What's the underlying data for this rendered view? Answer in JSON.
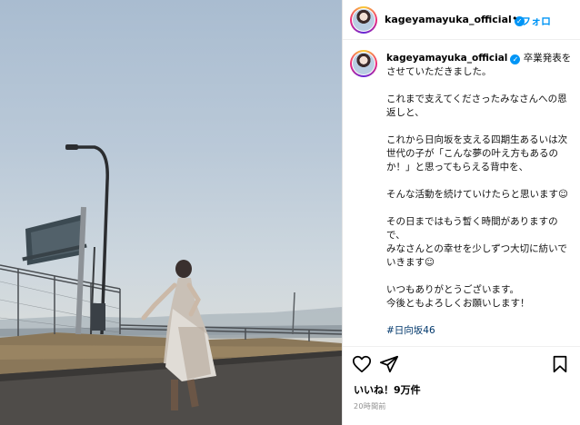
{
  "post": {
    "username": "kageyamayuka_official",
    "verified": true,
    "header_separator": "•",
    "follow_label": "フォロ",
    "caption_lines": [
      "卒業発表をさせていただきました。",
      "",
      "これまで支えてくださったみなさんへの恩返しと、",
      "",
      "これから日向坂を支える四期生あるいは次世代の子が「こんな夢の叶え方もあるのか！」と思ってもらえる背中を、",
      "",
      "そんな活動を続けていけたらと思います☺",
      "",
      "その日まではもう暫く時間がありますので、",
      "みなさんとの幸せを少しずつ大切に紡いでいきます☺",
      "",
      "いつもありがとうございます。",
      "今後ともよろしくお願いします！"
    ],
    "hashtag": "#日向坂46",
    "likes": "いいね！9万件",
    "timestamp": "20時間前"
  },
  "icons": {
    "like": "heart-icon",
    "share": "paper-plane-icon",
    "save": "bookmark-icon",
    "verified": "verified-badge-icon"
  },
  "colors": {
    "accent": "#0095f6",
    "hashtag": "#00376b",
    "timestamp": "#8e8e8e"
  }
}
